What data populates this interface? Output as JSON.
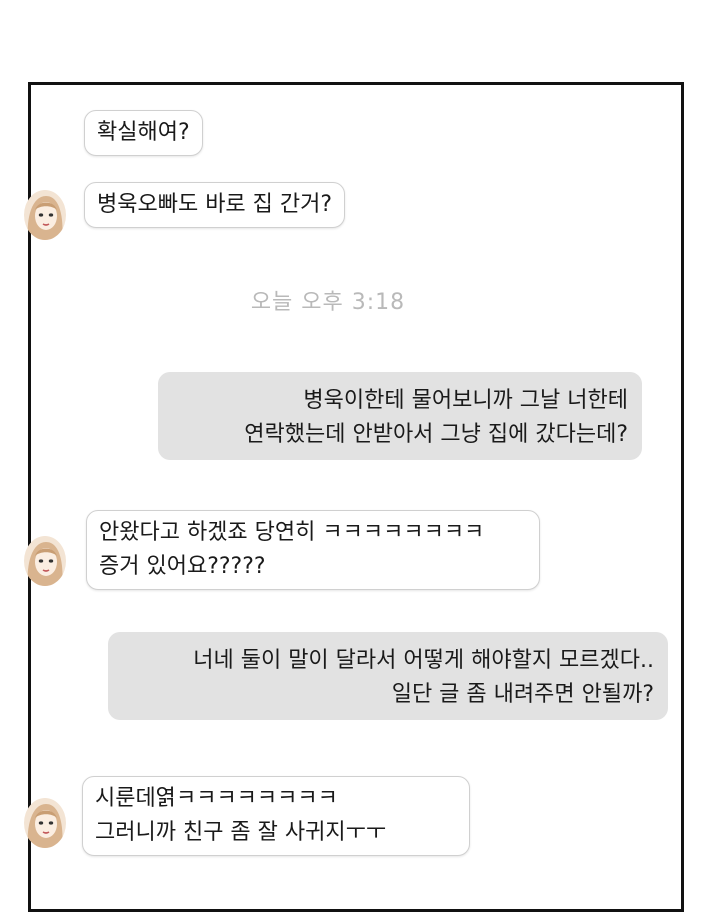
{
  "messages": [
    {
      "id": "m1",
      "direction": "incoming",
      "lines": [
        "확실해여?"
      ]
    },
    {
      "id": "m2",
      "direction": "incoming",
      "avatar": "girl-avatar",
      "lines": [
        "병욱오빠도 바로 집 간거?"
      ]
    },
    {
      "id": "m3",
      "direction": "outgoing",
      "lines": [
        "병욱이한테 물어보니까 그날 너한테",
        "연락했는데 안받아서 그냥 집에 갔다는데?"
      ]
    },
    {
      "id": "m4",
      "direction": "incoming",
      "avatar": "girl-avatar",
      "lines": [
        "안왔다고 하겠죠 당연히 ㅋㅋㅋㅋㅋㅋㅋㅋ",
        "증거 있어요?????"
      ]
    },
    {
      "id": "m5",
      "direction": "outgoing",
      "lines": [
        "너네 둘이 말이 달라서 어떻게 해야할지 모르겠다..",
        "일단 글 좀 내려주면 안될까?"
      ]
    },
    {
      "id": "m6",
      "direction": "incoming",
      "avatar": "girl-avatar",
      "lines": [
        "시룬데엵ㅋㅋㅋㅋㅋㅋㅋㅋ",
        "그러니까 친구 좀 잘 사귀지ㅜㅜ"
      ]
    }
  ],
  "timestamp": "오늘 오후 3:18",
  "colors": {
    "frame_border": "#111111",
    "incoming_bg": "#ffffff",
    "incoming_border": "#d0d0d0",
    "outgoing_bg": "#e2e2e2",
    "text": "#1a1a1a",
    "timestamp": "#b9b9b9",
    "avatar_hair": "#d9b48f"
  }
}
